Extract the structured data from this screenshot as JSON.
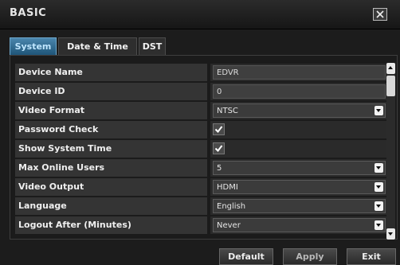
{
  "window": {
    "title": "BASIC",
    "close_icon": "close-icon"
  },
  "tabs": [
    {
      "label": "System",
      "active": true
    },
    {
      "label": "Date & Time",
      "active": false
    },
    {
      "label": "DST",
      "active": false
    }
  ],
  "settings": [
    {
      "label": "Device Name",
      "type": "text",
      "value": "EDVR"
    },
    {
      "label": "Device ID",
      "type": "text",
      "value": "0"
    },
    {
      "label": "Video Format",
      "type": "select",
      "value": "NTSC"
    },
    {
      "label": "Password Check",
      "type": "checkbox",
      "checked": true
    },
    {
      "label": "Show System Time",
      "type": "checkbox",
      "checked": true
    },
    {
      "label": "Max Online Users",
      "type": "select",
      "value": "5"
    },
    {
      "label": "Video Output",
      "type": "select",
      "value": "HDMI"
    },
    {
      "label": "Language",
      "type": "select",
      "value": "English"
    },
    {
      "label": "Logout After (Minutes)",
      "type": "select",
      "value": "Never"
    }
  ],
  "buttons": {
    "default": "Default",
    "apply": "Apply",
    "exit": "Exit"
  },
  "colors": {
    "active_tab": "#2f6e96",
    "background": "#1c1c1c",
    "label_row": "#343434"
  }
}
